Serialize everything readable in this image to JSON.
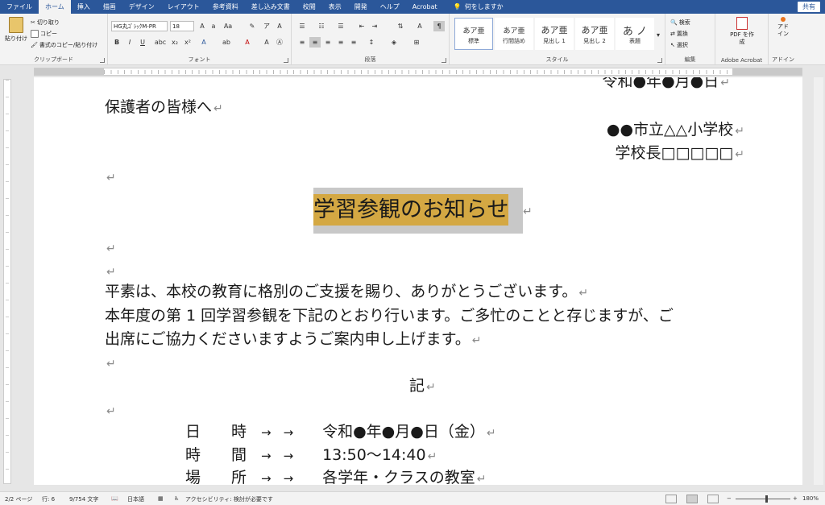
{
  "tabs": [
    "ファイル",
    "ホーム",
    "挿入",
    "描画",
    "デザイン",
    "レイアウト",
    "参考資料",
    "差し込み文書",
    "校閲",
    "表示",
    "開発",
    "ヘルプ",
    "Acrobat"
  ],
  "active_tab": "ホーム",
  "tell_me": "何をしますか",
  "share_label": "共有",
  "clipboard": {
    "paste": "貼り付け",
    "cut": "切り取り",
    "copy": "コピー",
    "format_painter": "書式のコピー/貼り付け",
    "label": "クリップボード"
  },
  "font": {
    "name": "HG丸ｺﾞｼｯｸM-PR",
    "size": "18",
    "label": "フォント"
  },
  "paragraph": {
    "label": "段落"
  },
  "styles": {
    "label": "スタイル",
    "items": [
      {
        "sample": "あア亜",
        "name": "標準"
      },
      {
        "sample": "あア亜",
        "name": "行間詰め"
      },
      {
        "sample": "あア亜",
        "name": "見出し 1"
      },
      {
        "sample": "あア亜",
        "name": "見出し 2"
      },
      {
        "sample": "あ ノ",
        "name": "表題"
      }
    ]
  },
  "editing": {
    "search": "検索",
    "replace": "置換",
    "select": "選択",
    "label": "編集"
  },
  "pdf": {
    "button": "PDF を作成",
    "label": "Adobe Acrobat"
  },
  "addin": {
    "button": "アド イン",
    "label": "アドイン"
  },
  "document": {
    "date": "令和●年●月●日",
    "recipient": "保護者の皆様へ",
    "school": "●●市立△△小学校",
    "principal": "学校長□□□□□",
    "title": "学習参観のお知らせ",
    "body_1": "平素は、本校の教育に格別のご支援を賜り、ありがとうございます。",
    "body_2": "本年度の第 1 回学習参観を下記のとおり行います。ご多忙のことと存じますが、ご",
    "body_3": "出席にご協力くださいますようご案内申し上げます。",
    "ki": "記",
    "rows": [
      {
        "label": "日　　時",
        "value": "令和●年●月●日（金）"
      },
      {
        "label": "時　　間",
        "value": "13:50～14:40"
      },
      {
        "label": "場　　所",
        "value": "各学年・クラスの教室"
      }
    ],
    "arrows": "→　→",
    "para_mark": "↵"
  },
  "status": {
    "page": "2/2 ページ",
    "line": "行: 6",
    "words": "9/754 文字",
    "language": "日本語",
    "accessibility": "アクセシビリティ: 検討が必要です",
    "zoom": "180%"
  },
  "colors": {
    "accent": "#2b579a",
    "title_highlight": "#d4a843",
    "title_shade": "#c8c8c8"
  }
}
